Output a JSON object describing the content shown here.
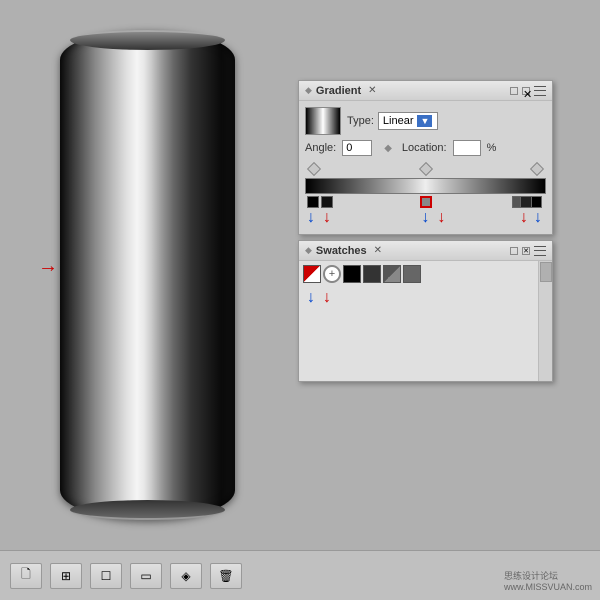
{
  "canvas": {
    "background": "#b0b0b0"
  },
  "cylinder": {
    "visible": true
  },
  "gradient_panel": {
    "title": "Gradient",
    "type_label": "Type:",
    "type_value": "Linear",
    "angle_label": "Angle:",
    "angle_value": "0",
    "location_label": "Location:",
    "location_value": "",
    "percent_label": "%"
  },
  "swatches_panel": {
    "title": "Swatches"
  },
  "toolbar": {
    "btn1": "🗋",
    "btn2": "⊞",
    "btn3": "☐",
    "btn4": "☐",
    "btn5": "◈",
    "btn6": "🗑"
  },
  "watermark": {
    "text1": "思练设计论坛",
    "text2": "www.MISSVUAN.com"
  }
}
